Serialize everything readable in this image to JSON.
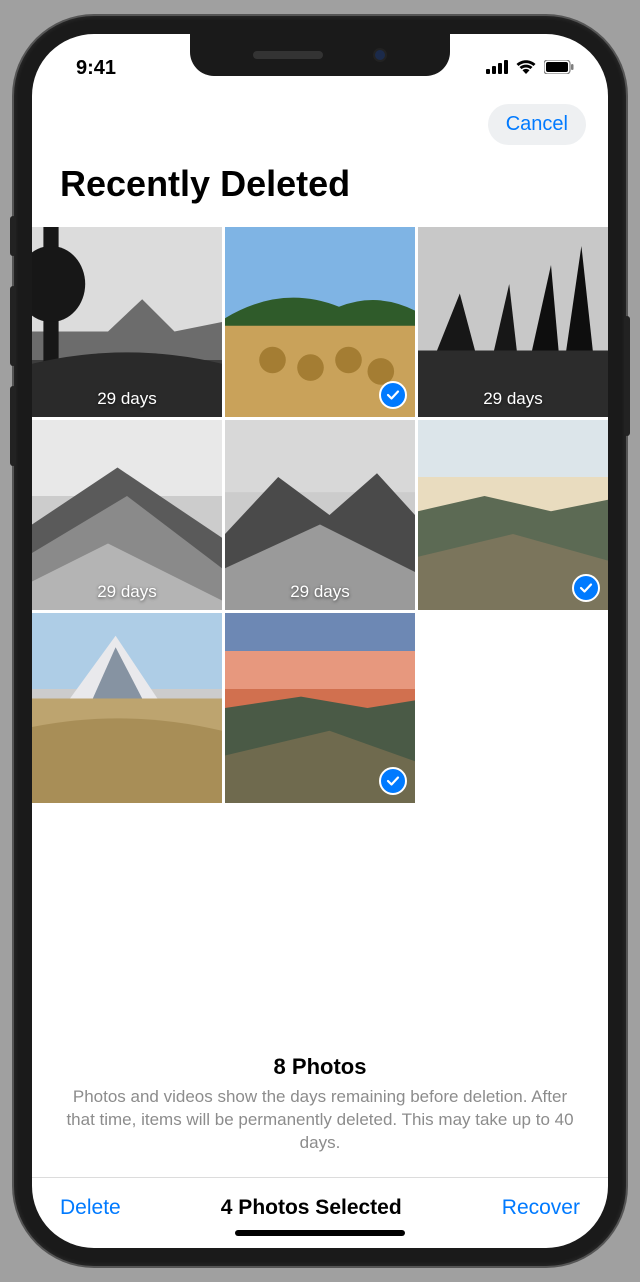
{
  "status": {
    "time": "9:41"
  },
  "nav": {
    "cancel": "Cancel"
  },
  "page_title": "Recently Deleted",
  "photos": [
    {
      "days_label": "29 days",
      "selected": false,
      "style": "bw"
    },
    {
      "days_label": "",
      "selected": true,
      "style": "color"
    },
    {
      "days_label": "29 days",
      "selected": false,
      "style": "bw"
    },
    {
      "days_label": "29 days",
      "selected": false,
      "style": "bw"
    },
    {
      "days_label": "29 days",
      "selected": false,
      "style": "bw"
    },
    {
      "days_label": "",
      "selected": true,
      "style": "color"
    },
    {
      "days_label": "",
      "selected": false,
      "style": "color"
    },
    {
      "days_label": "",
      "selected": true,
      "style": "color"
    }
  ],
  "summary": {
    "count_title": "8 Photos",
    "description": "Photos and videos show the days remaining before deletion. After that time, items will be permanently deleted. This may take up to 40 days."
  },
  "toolbar": {
    "delete": "Delete",
    "selected": "4 Photos Selected",
    "recover": "Recover"
  }
}
